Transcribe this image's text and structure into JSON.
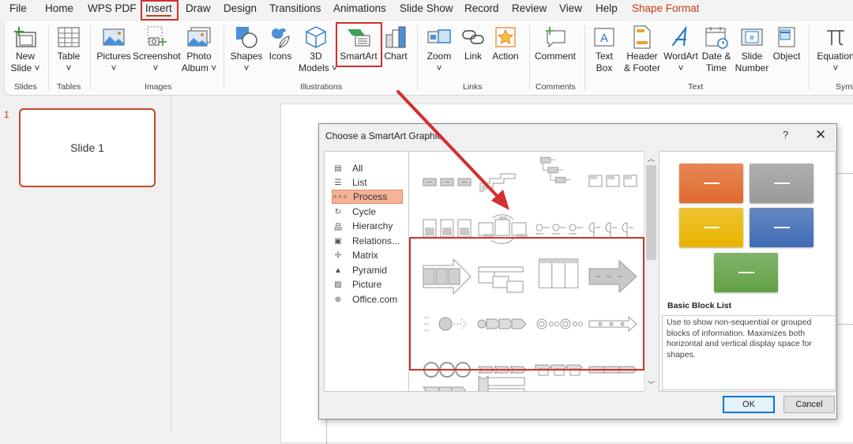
{
  "menubar": {
    "tabs": [
      "File",
      "Home",
      "WPS PDF",
      "Insert",
      "Draw",
      "Design",
      "Transitions",
      "Animations",
      "Slide Show",
      "Record",
      "Review",
      "View",
      "Help",
      "Shape Format"
    ],
    "active_tab": "Insert",
    "contextual_tab": "Shape Format"
  },
  "ribbon": {
    "groups": {
      "slides": "Slides",
      "tables": "Tables",
      "images": "Images",
      "illustrations": "Illustrations",
      "links": "Links",
      "comments": "Comments",
      "text": "Text",
      "symbols": "Symb"
    },
    "buttons": {
      "new_slide": [
        "New",
        "Slide ˅"
      ],
      "table": [
        "Table",
        "˅"
      ],
      "pictures": [
        "Pictures",
        "˅"
      ],
      "screenshot": [
        "Screenshot",
        "˅"
      ],
      "photo_album": [
        "Photo",
        "Album ˅"
      ],
      "shapes": [
        "Shapes",
        "˅"
      ],
      "icons": [
        "Icons",
        ""
      ],
      "models_3d": [
        "3D",
        "Models ˅"
      ],
      "smartart": [
        "SmartArt",
        ""
      ],
      "chart": [
        "Chart",
        ""
      ],
      "zoom": [
        "Zoom",
        "˅"
      ],
      "link": [
        "Link",
        ""
      ],
      "action": [
        "Action",
        ""
      ],
      "comment": [
        "Comment",
        ""
      ],
      "text_box": [
        "Text",
        "Box"
      ],
      "header_footer": [
        "Header",
        "& Footer"
      ],
      "wordart": [
        "WordArt",
        "˅"
      ],
      "date_time": [
        "Date &",
        "Time"
      ],
      "slide_number": [
        "Slide",
        "Number"
      ],
      "object": [
        "Object",
        ""
      ],
      "equation": [
        "Equation",
        "˅"
      ]
    }
  },
  "slides_pane": {
    "slide_number": "1",
    "slide_label": "Slide 1"
  },
  "dialog": {
    "title": "Choose a SmartArt Graphic",
    "help": "?",
    "close": "✕",
    "categories": [
      {
        "label": "All",
        "icon": "all-icon"
      },
      {
        "label": "List",
        "icon": "list-icon"
      },
      {
        "label": "Process",
        "icon": "process-icon"
      },
      {
        "label": "Cycle",
        "icon": "cycle-icon"
      },
      {
        "label": "Hierarchy",
        "icon": "hierarchy-icon"
      },
      {
        "label": "Relations...",
        "icon": "relationship-icon"
      },
      {
        "label": "Matrix",
        "icon": "matrix-icon"
      },
      {
        "label": "Pyramid",
        "icon": "pyramid-icon"
      },
      {
        "label": "Picture",
        "icon": "picture-icon"
      },
      {
        "label": "Office.com",
        "icon": "globe-icon"
      }
    ],
    "selected_category": "Process",
    "preview": {
      "title": "Basic Block List",
      "description": "Use to show non-sequential or grouped blocks of information. Maximizes both horizontal and vertical display space for shapes.",
      "block_colors": [
        "#e06a2c",
        "#9a9a9a",
        "#e8b400",
        "#3f6cb5",
        "#62a144"
      ]
    },
    "ok_label": "OK",
    "cancel_label": "Cancel"
  }
}
